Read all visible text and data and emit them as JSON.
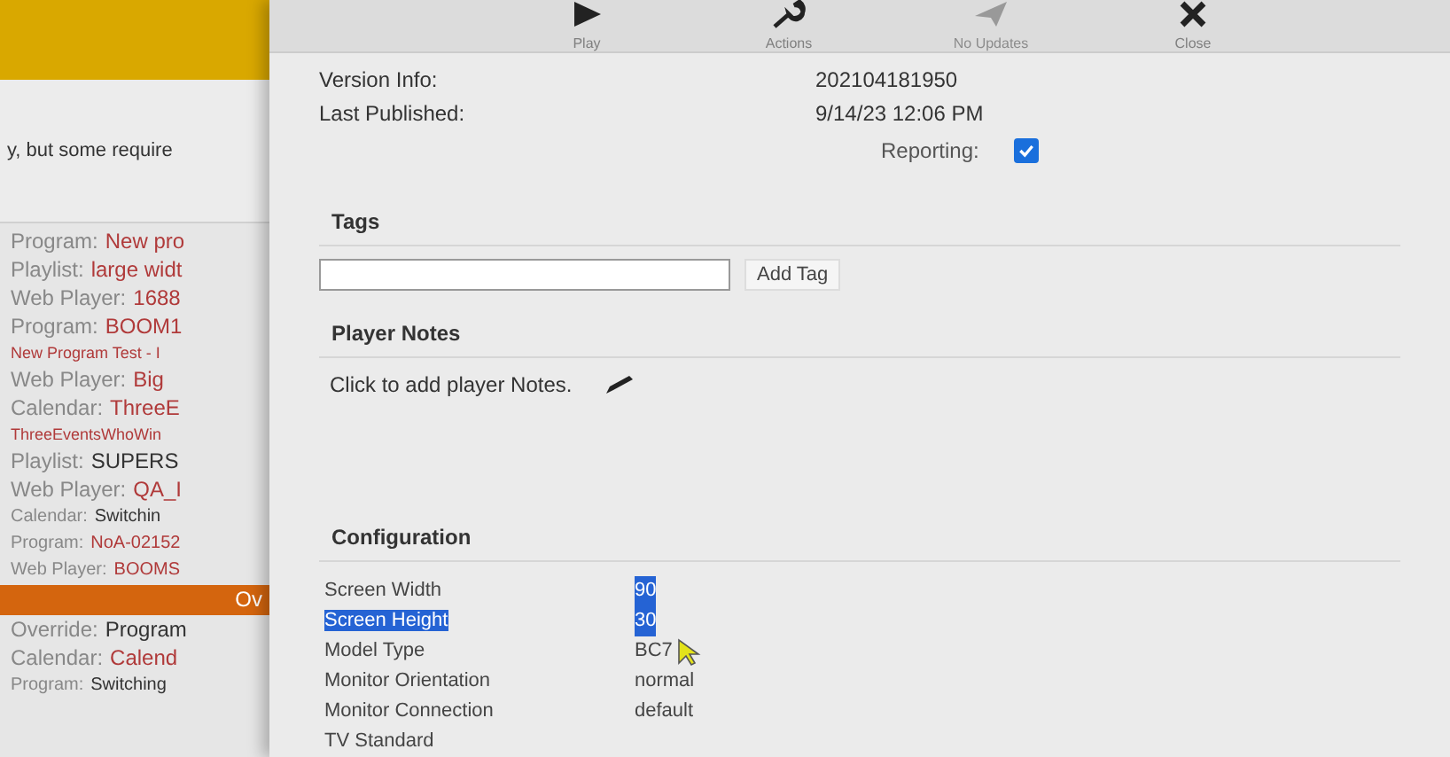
{
  "background_page": {
    "notice": "y, but some require",
    "entries": [
      {
        "kind": "pair",
        "label": "Program:",
        "value": "New pro",
        "color": "#b03a3a"
      },
      {
        "kind": "pair",
        "label": "Playlist:",
        "value": "large widt",
        "color": "#b03a3a"
      },
      {
        "kind": "pair",
        "label": "Web Player:",
        "value": "1688",
        "color": "#b03a3a"
      },
      {
        "kind": "pair",
        "label": "Program:",
        "value": "BOOM1",
        "color": "#b03a3a"
      },
      {
        "kind": "line",
        "text": "New Program Test - I",
        "color": "#b03a3a"
      },
      {
        "kind": "pair",
        "label": "Web Player:",
        "value": "Big",
        "color": "#b03a3a"
      },
      {
        "kind": "pair",
        "label": "Calendar:",
        "value": "ThreeE",
        "color": "#b03a3a"
      },
      {
        "kind": "line",
        "text": "ThreeEventsWhoWin",
        "color": "#b03a3a"
      },
      {
        "kind": "pair",
        "label": "Playlist:",
        "value": "SUPERS",
        "color": "#333333"
      },
      {
        "kind": "pair",
        "label": "Web Player:",
        "value": "QA_I",
        "color": "#b03a3a"
      },
      {
        "kind": "small_pair",
        "label": "Calendar:",
        "value": "Switchin",
        "color": "#333333"
      },
      {
        "kind": "small_pair",
        "label": "Program:",
        "value": "NoA-02152",
        "color": "#b03a3a"
      },
      {
        "kind": "small_pair",
        "label": "Web Player:",
        "value": "BOOMS",
        "color": "#b03a3a"
      },
      {
        "kind": "banner",
        "text": "Ov"
      },
      {
        "kind": "pair",
        "label": "Override:",
        "value": "Program",
        "color": "#333333"
      },
      {
        "kind": "pair",
        "label": "Calendar:",
        "value": "Calend",
        "color": "#b03a3a"
      },
      {
        "kind": "small_pair",
        "label": "Program:",
        "value": "Switching",
        "color": "#333333"
      }
    ]
  },
  "toolbar": [
    {
      "kind": "play",
      "label": "Play",
      "disabled": false
    },
    {
      "kind": "actions",
      "label": "Actions",
      "disabled": false
    },
    {
      "kind": "no_updates",
      "label": "No Updates",
      "disabled": true
    },
    {
      "kind": "close",
      "label": "Close",
      "disabled": false
    }
  ],
  "info": [
    {
      "label": "Version Info:",
      "value": "202104181950"
    },
    {
      "label": "Last Published:",
      "value": "9/14/23 12:06 PM"
    }
  ],
  "reporting": {
    "label": "Reporting:",
    "checked": true
  },
  "tags": {
    "title": "Tags",
    "button": "Add Tag"
  },
  "player_notes": {
    "title": "Player Notes",
    "text": "Click to add player Notes."
  },
  "configuration": {
    "title": "Configuration",
    "rows": [
      {
        "label": "Screen Width",
        "value": "90",
        "label_selected": false,
        "value_selected": true
      },
      {
        "label": "Screen Height",
        "value": "30",
        "label_selected": true,
        "value_selected": true
      },
      {
        "label": "Model Type",
        "value": "BC7",
        "label_selected": false,
        "value_selected": false
      },
      {
        "label": "Monitor Orientation",
        "value": "normal",
        "label_selected": false,
        "value_selected": false
      },
      {
        "label": "Monitor Connection",
        "value": "default",
        "label_selected": false,
        "value_selected": false
      },
      {
        "label": "TV Standard",
        "label_selected": false
      }
    ]
  }
}
